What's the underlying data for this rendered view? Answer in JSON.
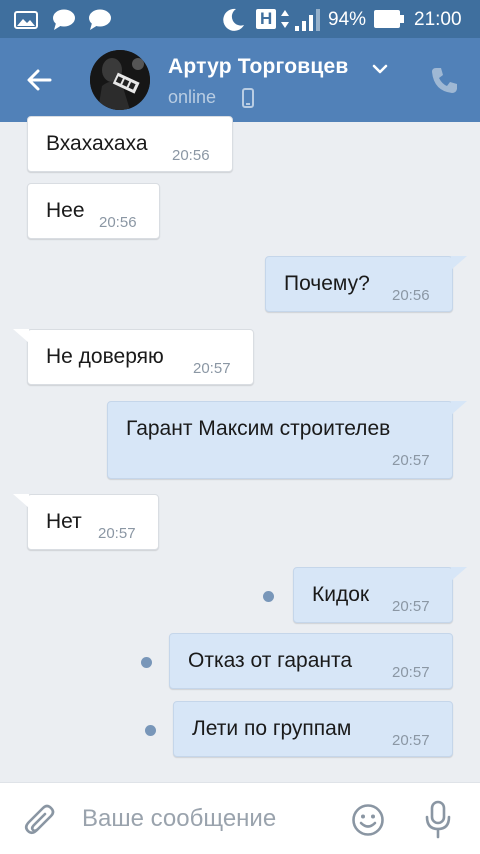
{
  "status_bar": {
    "battery": "94%",
    "time": "21:00",
    "network_letter": "H"
  },
  "header": {
    "contact_name": "Артур Торговцев",
    "status": "online"
  },
  "messages": [
    {
      "direction": "in",
      "text": "Вхахахаха",
      "time": "20:56"
    },
    {
      "direction": "in",
      "text": "Нее",
      "time": "20:56"
    },
    {
      "direction": "out",
      "text": "Почему?",
      "time": "20:56"
    },
    {
      "direction": "in",
      "text": "Не доверяю",
      "time": "20:57"
    },
    {
      "direction": "out",
      "text": "Гарант Максим строителев",
      "time": "20:57"
    },
    {
      "direction": "in",
      "text": "Нет",
      "time": "20:57"
    },
    {
      "direction": "out",
      "text": "Кидок",
      "time": "20:57",
      "unread": true
    },
    {
      "direction": "out",
      "text": "Отказ от гаранта",
      "time": "20:57",
      "unread": true
    },
    {
      "direction": "out",
      "text": "Лети по группам",
      "time": "20:57",
      "unread": true
    }
  ],
  "composer": {
    "placeholder": "Ваше сообщение"
  },
  "colors": {
    "header": "#5181b8",
    "status_bar": "#3f6f9e",
    "incoming_bubble": "#ffffff",
    "outgoing_bubble": "#d7e6f7",
    "unread_dot": "#7896b9",
    "background": "#ebeef2"
  },
  "icons": [
    "gallery-icon",
    "chat-bubble-icon",
    "moon-icon",
    "vibrate-icon",
    "signal-icon",
    "battery-icon",
    "back-arrow-icon",
    "chevron-down-icon",
    "phone-icon",
    "paperclip-icon",
    "emoji-icon",
    "microphone-icon"
  ]
}
